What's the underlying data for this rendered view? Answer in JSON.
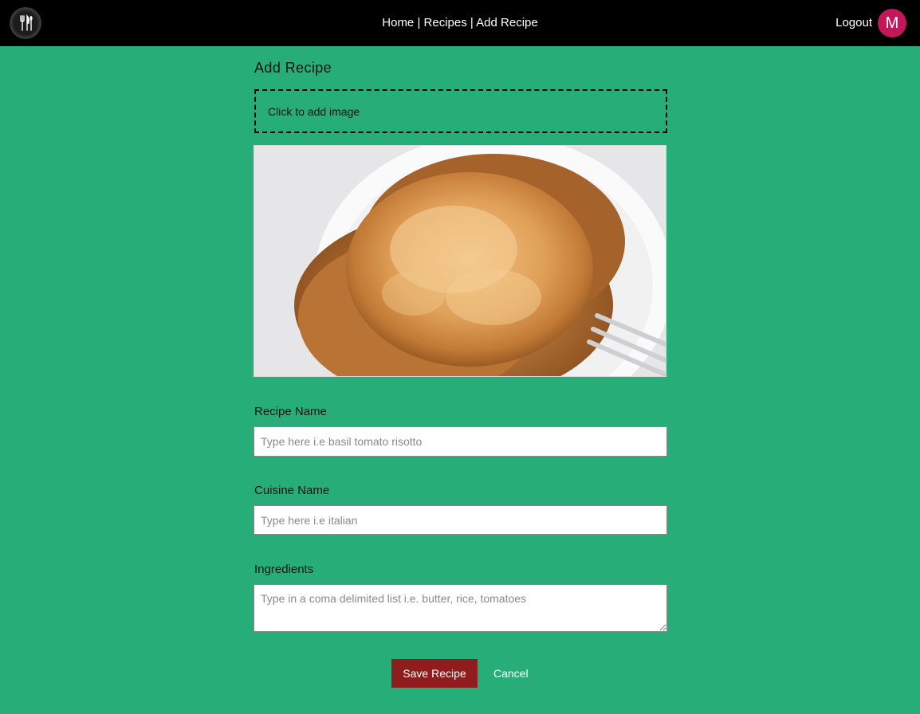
{
  "header": {
    "nav": {
      "home": "Home",
      "recipes": "Recipes",
      "add_recipe": "Add Recipe",
      "separator": "|"
    },
    "logout_label": "Logout",
    "avatar_initial": "M",
    "logo_icon": "cutlery-icon"
  },
  "form": {
    "title": "Add Recipe",
    "image_drop_label": "Click to add image",
    "image_preview": "pancakes-on-plate-with-fork",
    "recipe_name": {
      "label": "Recipe Name",
      "value": "",
      "placeholder": "Type here i.e basil tomato risotto"
    },
    "cuisine_name": {
      "label": "Cuisine Name",
      "value": "",
      "placeholder": "Type here i.e italian"
    },
    "ingredients": {
      "label": "Ingredients",
      "value": "",
      "placeholder": "Type in a coma delimited list i.e. butter, rice, tomatoes"
    },
    "save_label": "Save Recipe",
    "cancel_label": "Cancel"
  },
  "colors": {
    "page_background": "#27ae78",
    "header_background": "#000000",
    "avatar": "#c2185b",
    "save_button": "#8f1d1d"
  }
}
